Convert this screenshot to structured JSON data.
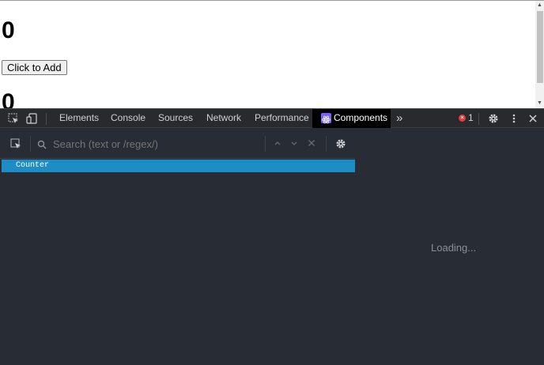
{
  "page": {
    "counter_value_top": "0",
    "add_button_label": "Click to Add",
    "counter_value_bottom": "0"
  },
  "devtools": {
    "tabs": [
      {
        "label": "Elements"
      },
      {
        "label": "Console"
      },
      {
        "label": "Sources"
      },
      {
        "label": "Network"
      },
      {
        "label": "Performance"
      },
      {
        "label": "Components",
        "active": true
      }
    ],
    "more_tabs_glyph": "»",
    "error_count": "1",
    "components": {
      "search_placeholder": "Search (text or /regex/)",
      "tree_items": [
        {
          "label": "Counter",
          "selected": true
        }
      ],
      "details_status": "Loading..."
    }
  },
  "colors": {
    "devtools_bg": "#282c34",
    "selected_row": "#1e8dc6",
    "error_badge": "#e83a3a",
    "react_badge": "#7b61ff"
  },
  "icons": [
    "inspect-icon",
    "device-toggle-icon",
    "react-icon",
    "error-icon",
    "settings-icon",
    "more-vert-icon",
    "close-icon",
    "select-element-icon",
    "search-icon",
    "arrow-up-icon",
    "arrow-down-icon",
    "clear-icon",
    "component-settings-icon"
  ]
}
